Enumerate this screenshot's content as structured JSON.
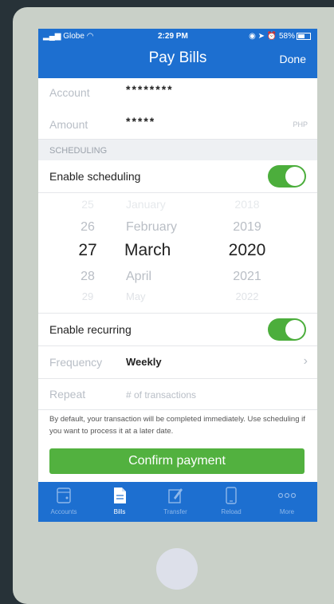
{
  "status": {
    "carrier": "Globe",
    "time": "2:29 PM",
    "battery": "58%"
  },
  "nav": {
    "title": "Pay Bills",
    "done": "Done"
  },
  "form": {
    "account_label": "Account",
    "account_value": "********",
    "amount_label": "Amount",
    "amount_value": "*****",
    "amount_currency": "PHP"
  },
  "scheduling": {
    "section_header": "SCHEDULING",
    "enable_label": "Enable scheduling",
    "enabled": true,
    "picker": {
      "days": [
        "25",
        "26",
        "27",
        "28",
        "29"
      ],
      "months": [
        "January",
        "February",
        "March",
        "April",
        "May"
      ],
      "years": [
        "2018",
        "2019",
        "2020",
        "2021",
        "2022"
      ]
    },
    "recurring_label": "Enable recurring",
    "recurring": true,
    "frequency_label": "Frequency",
    "frequency_value": "Weekly",
    "repeat_label": "Repeat",
    "repeat_placeholder": "# of transactions"
  },
  "help_text": "By default, your transaction will be completed immediately. Use scheduling if you want to process it at a later date.",
  "confirm_label": "Confirm payment",
  "tabs": [
    {
      "label": "Accounts",
      "icon": "accounts-icon"
    },
    {
      "label": "Bills",
      "icon": "bills-icon"
    },
    {
      "label": "Transfer",
      "icon": "transfer-icon"
    },
    {
      "label": "Reload",
      "icon": "reload-icon"
    },
    {
      "label": "More",
      "icon": "more-icon"
    }
  ],
  "colors": {
    "nav_blue": "#1d6fd0",
    "toggle_green": "#4cae3c",
    "button_green": "#52b13f"
  }
}
